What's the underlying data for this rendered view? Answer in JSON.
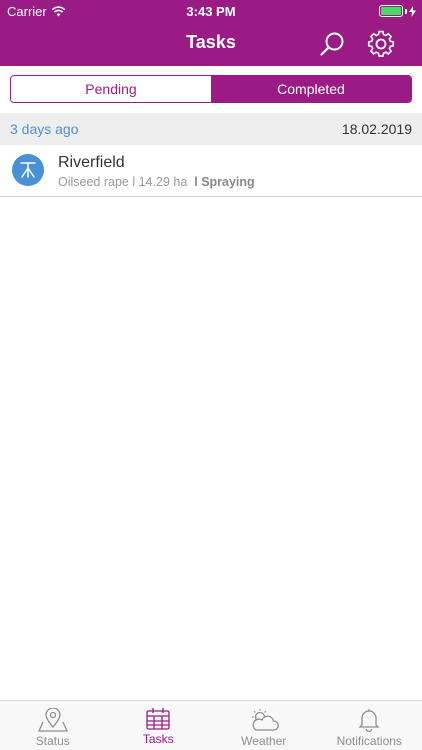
{
  "status_bar": {
    "carrier": "Carrier",
    "time": "3:43 PM"
  },
  "nav": {
    "title": "Tasks",
    "search_icon": "search-icon",
    "settings_icon": "gear-icon"
  },
  "segments": [
    {
      "label": "Pending",
      "selected": false
    },
    {
      "label": "Completed",
      "selected": true
    }
  ],
  "section": {
    "relative": "3 days ago",
    "date": "18.02.2019"
  },
  "tasks": [
    {
      "title": "Riverfield",
      "crop": "Oilseed rape",
      "area": "14.29 ha",
      "type": "Spraying",
      "icon": "sprayer-icon"
    }
  ],
  "tabs": [
    {
      "label": "Status",
      "icon": "map-pin-icon"
    },
    {
      "label": "Tasks",
      "icon": "calendar-grid-icon"
    },
    {
      "label": "Weather",
      "icon": "weather-icon"
    },
    {
      "label": "Notifications",
      "icon": "bell-icon"
    }
  ],
  "colors": {
    "brand": "#9b1b85",
    "accent": "#4a90d9",
    "battery": "#4cd964"
  }
}
